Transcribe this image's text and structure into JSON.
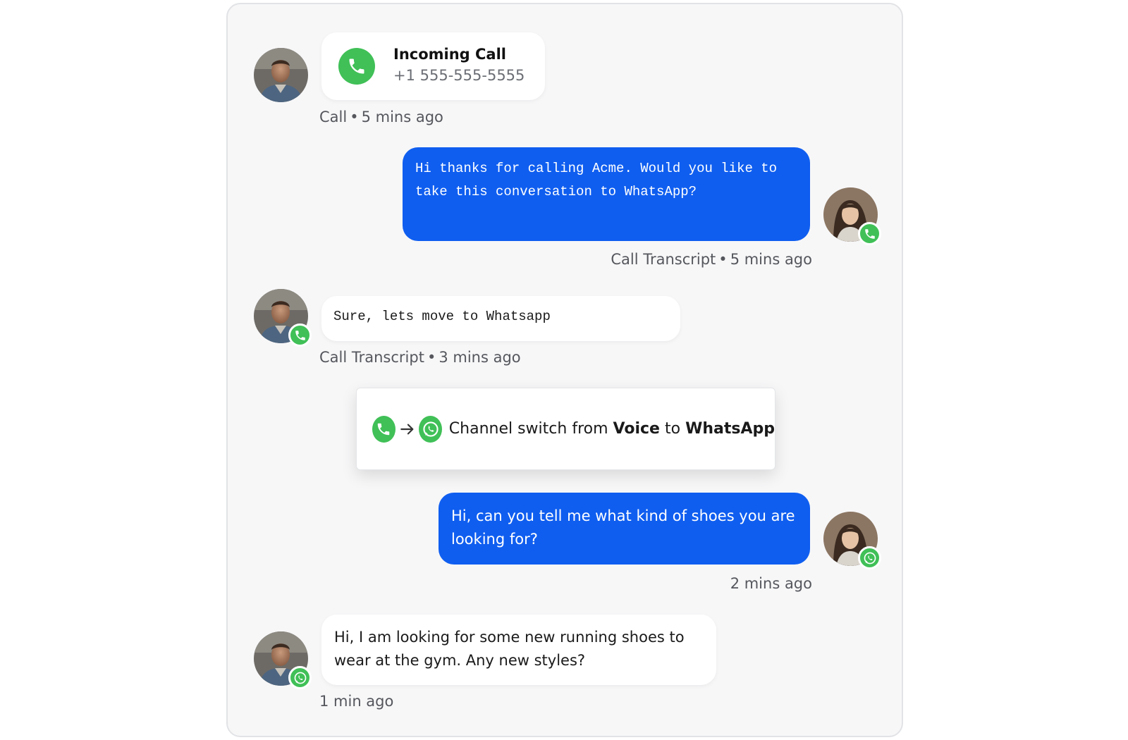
{
  "colors": {
    "accent_blue": "#0f5ef0",
    "green": "#40c057",
    "panel_bg": "#f7f7f8",
    "meta_text": "#55575d"
  },
  "incoming_call": {
    "icon": "phone-icon",
    "title": "Incoming Call",
    "number": "+1 555-555-5555",
    "meta_channel": "Call",
    "meta_time": "5 mins ago"
  },
  "messages": [
    {
      "direction": "outgoing",
      "text": "Hi thanks for calling Acme. Would you like to take this conversation to WhatsApp?",
      "badge_icon": "phone-icon",
      "meta_channel": "Call Transcript",
      "meta_time": "5 mins ago"
    },
    {
      "direction": "incoming",
      "text": "Sure, lets move to Whatsapp",
      "badge_icon": "phone-icon",
      "meta_channel": "Call Transcript",
      "meta_time": "3 mins ago"
    },
    {
      "direction": "outgoing",
      "text": "Hi, can you tell me what kind of shoes you are looking for?",
      "badge_icon": "whatsapp-icon",
      "meta_time": "2 mins ago"
    },
    {
      "direction": "incoming",
      "text": "Hi, I am looking for some new running shoes to wear at the gym. Any new styles?",
      "badge_icon": "whatsapp-icon",
      "meta_time": "1 min ago"
    }
  ],
  "channel_switch": {
    "from_icon": "phone-icon",
    "arrow_icon": "arrow-right-icon",
    "to_icon": "whatsapp-icon",
    "prefix": "Channel switch from",
    "from": "Voice",
    "connector": "to",
    "to": "WhatsApp"
  },
  "separator": "•"
}
